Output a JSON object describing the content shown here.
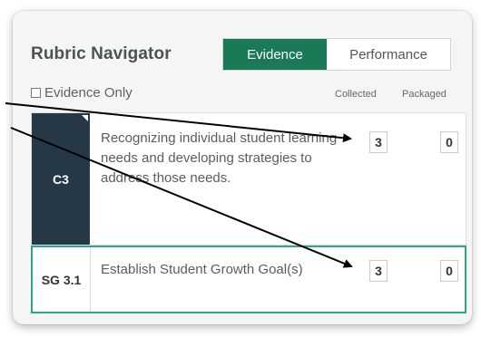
{
  "navigator": {
    "title": "Rubric Navigator",
    "tabs": {
      "evidence": "Evidence",
      "performance": "Performance"
    },
    "filter_label": "Evidence Only",
    "columns": {
      "collected": "Collected",
      "packaged": "Packaged"
    }
  },
  "rows": [
    {
      "label": "C3",
      "description": "Recognizing individual student learning needs and developing strategies to address those needs.",
      "collected": "3",
      "packaged": "0"
    },
    {
      "label": "SG 3.1",
      "description": "Establish Student Growth Goal(s)",
      "collected": "3",
      "packaged": "0"
    }
  ],
  "colors": {
    "accent": "#1b7a56",
    "selected_border": "#2aa887",
    "label_dark": "#263846"
  },
  "annotation": {
    "arrow_count": 2,
    "arrow_color": "#000000"
  }
}
